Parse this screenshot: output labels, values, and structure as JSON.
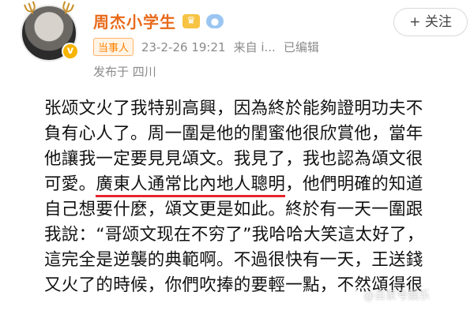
{
  "post": {
    "author": "周杰小学生",
    "role_badge": "当事人",
    "timestamp": "23-2-26 19:21",
    "source": "来自 i...",
    "edited": "已编辑",
    "location": "发布于 四川",
    "follow_label": "+ 关注",
    "icons": {
      "avatar": "avatar-photo",
      "verified": "verified-icon",
      "crown": "crown-icon",
      "fish": "fish-icon"
    },
    "body": {
      "line1": "张颂文火了我特别高興，因為終於能夠證明功夫不",
      "line2": "負有心人了。周一圍是他的閨蜜他很欣賞他，當年",
      "line3": "他讓我一定要見見頌文。我見了，我也認為頌文很",
      "line4_pre": "可愛。",
      "line4_hl": "廣東人通常比內地人聰明",
      "line4_post": "，他們明確的知道",
      "line5": "自己想要什麼，頌文更是如此。終於有一天一圍跟",
      "line6": "我說：“哥颂文现在不穷了”我哈哈大笑這太好了，",
      "line7": "這完全是逆襲的典範啊。不過很快有一天，王送錢",
      "line8": "又火了的時候，你們吹捧的要輕一點，不然頌得很"
    },
    "highlight_color": "#e8232c"
  },
  "watermark": "@百家号娱乐"
}
